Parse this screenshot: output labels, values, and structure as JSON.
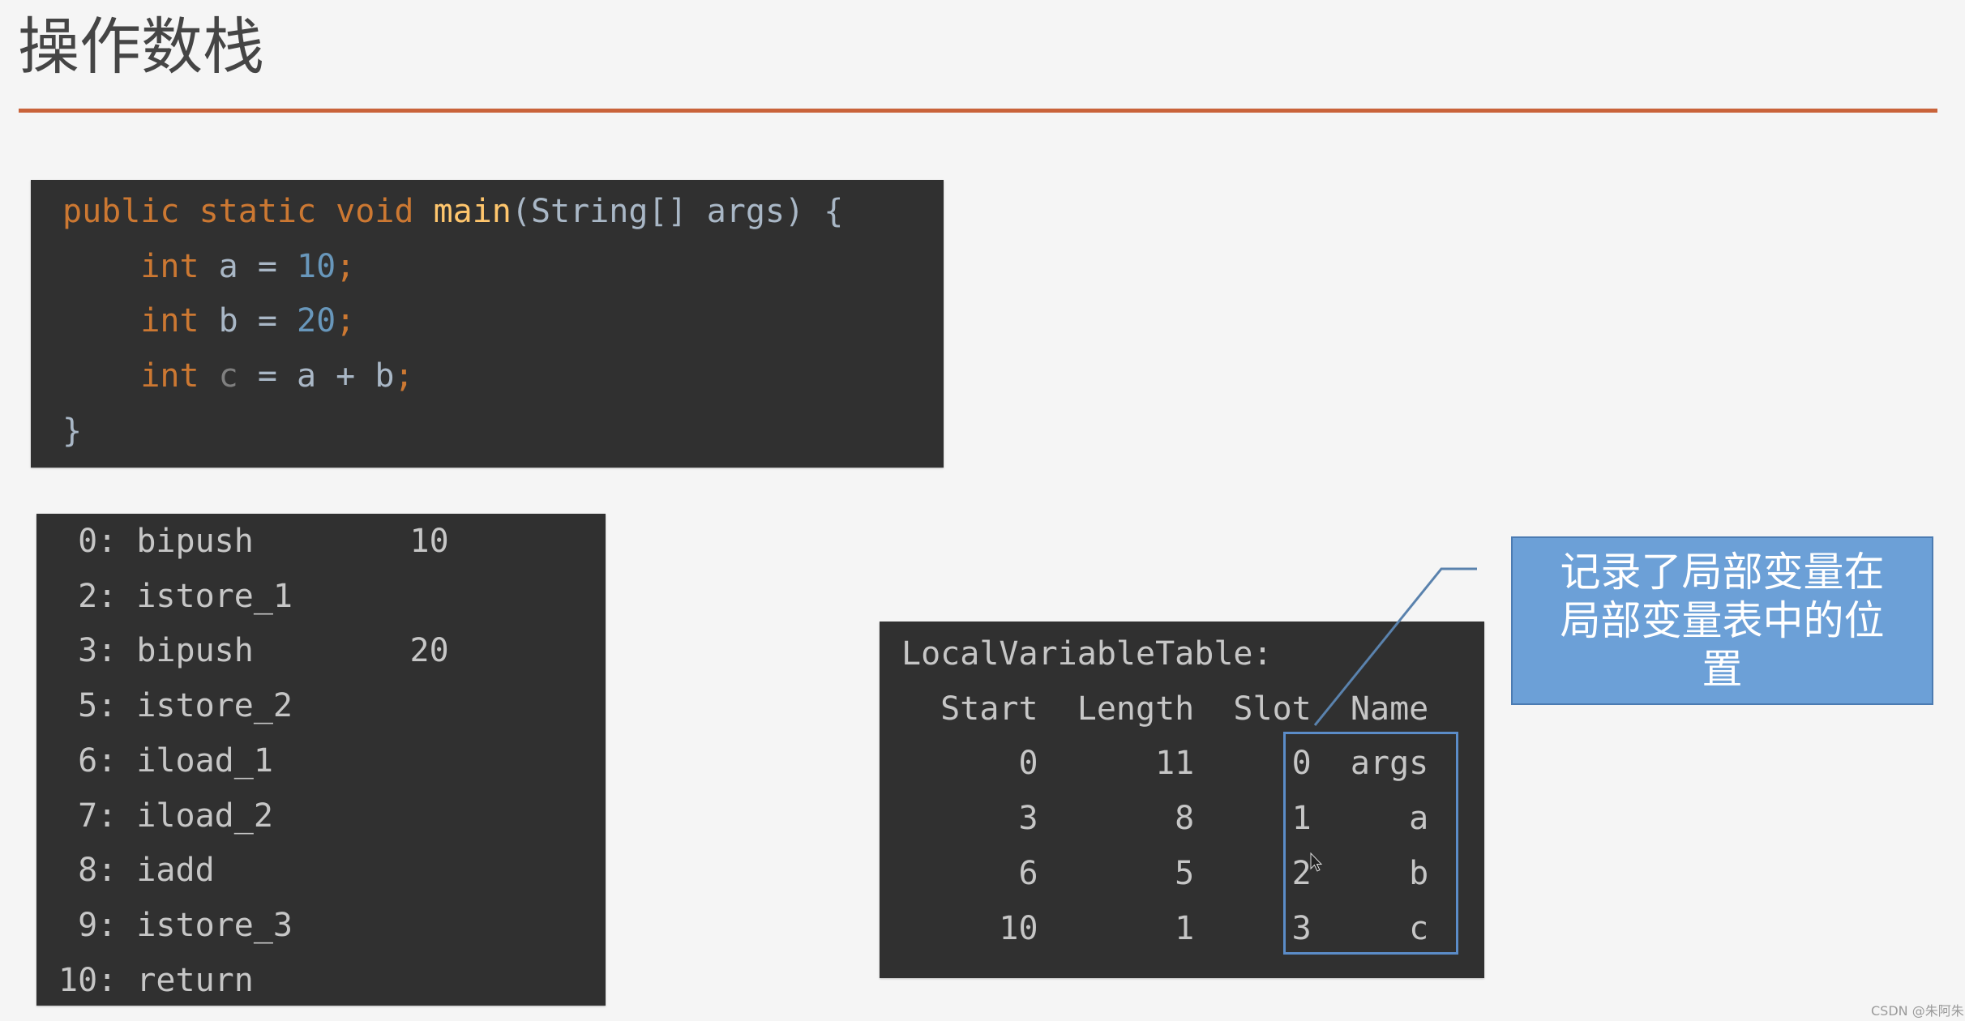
{
  "page": {
    "title": "操作数栈",
    "accent_color": "#c9633a"
  },
  "source_code": {
    "lines": [
      [
        {
          "t": "public static void ",
          "c": "kw"
        },
        {
          "t": "main",
          "c": "fn"
        },
        {
          "t": "(String[] args) {",
          "c": "id"
        }
      ],
      [
        {
          "t": "    int ",
          "c": "kw"
        },
        {
          "t": "a = ",
          "c": "id"
        },
        {
          "t": "10",
          "c": "num"
        },
        {
          "t": ";",
          "c": "kw"
        }
      ],
      [
        {
          "t": "    int ",
          "c": "kw"
        },
        {
          "t": "b = ",
          "c": "id"
        },
        {
          "t": "20",
          "c": "num"
        },
        {
          "t": ";",
          "c": "kw"
        }
      ],
      [
        {
          "t": "    int ",
          "c": "kw"
        },
        {
          "t": "c",
          "c": "unused"
        },
        {
          "t": " = a + b",
          "c": "id"
        },
        {
          "t": ";",
          "c": "kw"
        }
      ],
      [
        {
          "t": "}",
          "c": "id"
        }
      ]
    ]
  },
  "bytecode": {
    "instructions": [
      {
        "offset": "0",
        "op": "bipush",
        "arg": "10"
      },
      {
        "offset": "2",
        "op": "istore_1",
        "arg": ""
      },
      {
        "offset": "3",
        "op": "bipush",
        "arg": "20"
      },
      {
        "offset": "5",
        "op": "istore_2",
        "arg": ""
      },
      {
        "offset": "6",
        "op": "iload_1",
        "arg": ""
      },
      {
        "offset": "7",
        "op": "iload_2",
        "arg": ""
      },
      {
        "offset": "8",
        "op": "iadd",
        "arg": ""
      },
      {
        "offset": "9",
        "op": "istore_3",
        "arg": ""
      },
      {
        "offset": "10",
        "op": "return",
        "arg": ""
      }
    ]
  },
  "local_variable_table": {
    "title": "LocalVariableTable:",
    "headers": [
      "Start",
      "Length",
      "Slot",
      "Name"
    ],
    "rows": [
      {
        "start": "0",
        "length": "11",
        "slot": "0",
        "name": "args"
      },
      {
        "start": "3",
        "length": "8",
        "slot": "1",
        "name": "a"
      },
      {
        "start": "6",
        "length": "5",
        "slot": "2",
        "name": "b"
      },
      {
        "start": "10",
        "length": "1",
        "slot": "3",
        "name": "c"
      }
    ]
  },
  "callout": {
    "text": "记录了局部变量在局部变量表中的位置",
    "color": "#6ca0d7"
  },
  "watermark": "CSDN @朱阿朱"
}
